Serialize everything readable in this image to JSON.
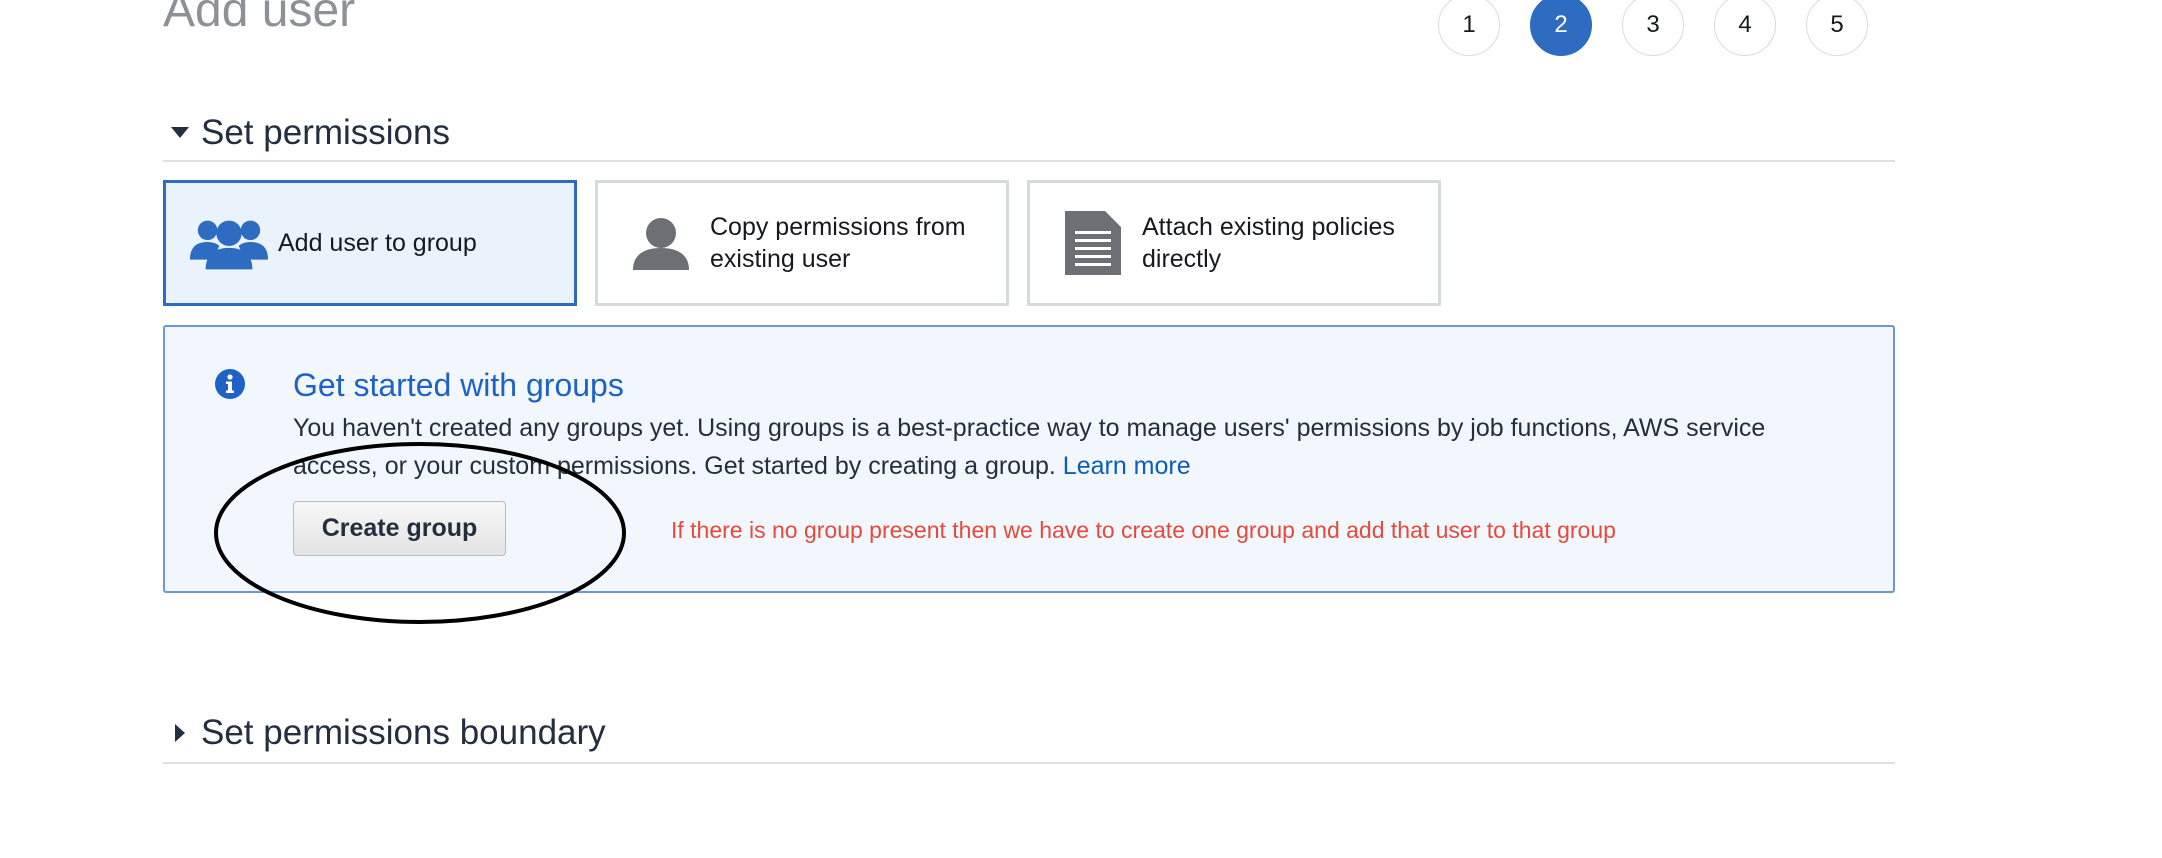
{
  "page": {
    "title": "Add user"
  },
  "steps": [
    "1",
    "2",
    "3",
    "4",
    "5"
  ],
  "active_step": "2",
  "permissions_section": {
    "title": "Set permissions",
    "options": [
      {
        "label": "Add user to group",
        "icon": "users-group-icon",
        "selected": true
      },
      {
        "label": "Copy permissions from existing user",
        "icon": "user-icon",
        "selected": false
      },
      {
        "label": "Attach existing policies directly",
        "icon": "document-icon",
        "selected": false
      }
    ]
  },
  "info": {
    "title": "Get started with groups",
    "body": "You haven't created any groups yet. Using groups is a best-practice way to manage users' permissions by job functions, AWS service access, or your custom permissions. Get started by creating a group.",
    "link_label": "Learn more",
    "button_label": "Create group",
    "annotation": "If there is no group present then we have to create one group and add that user to that group"
  },
  "boundary_section": {
    "title": "Set permissions boundary"
  },
  "colors": {
    "accent": "#2d6cc0",
    "info_title": "#1f62c5",
    "annotation": "#e64a3b",
    "selected_bg": "#eaf3fc"
  }
}
